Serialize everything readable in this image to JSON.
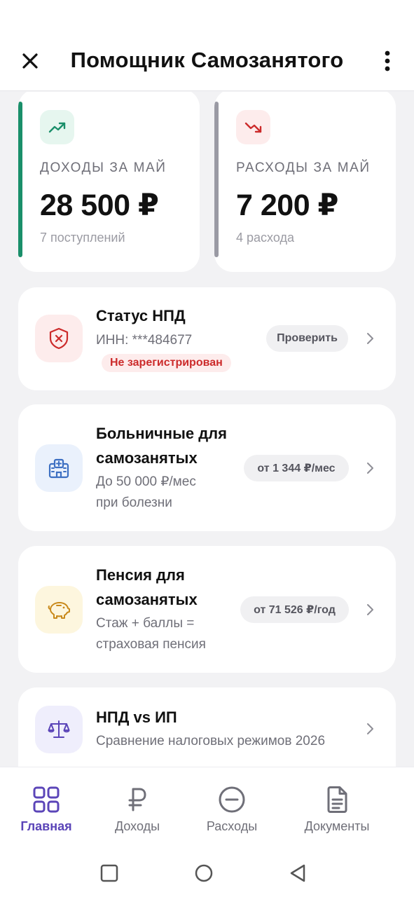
{
  "header": {
    "title": "Помощник Самозанятого"
  },
  "stats": {
    "income": {
      "label": "ДОХОДЫ ЗА МАЙ",
      "value": "28 500 ₽",
      "sub": "7 поступлений",
      "accent": "#1a8f6a"
    },
    "expense": {
      "label": "РАСХОДЫ ЗА МАЙ",
      "value": "7 200 ₽",
      "sub": "4 расхода",
      "accent": "#9a9aa4"
    }
  },
  "cards": {
    "npd": {
      "title": "Статус НПД",
      "desc": "ИНН: ***484677",
      "badge": "Не зарегистрирован",
      "action": "Проверить"
    },
    "sick": {
      "title_1": "Больничные для",
      "title_2": "самозанятых",
      "desc_1": "До 50 000 ₽/мес",
      "desc_2": "при болезни",
      "action": "от 1 344 ₽/мес"
    },
    "pension": {
      "title_1": "Пенсия для",
      "title_2": "самозанятых",
      "desc_1": "Стаж + баллы =",
      "desc_2": "страховая пенсия",
      "action": "от 71 526 ₽/год"
    },
    "compare": {
      "title": "НПД vs ИП",
      "desc": "Сравнение налоговых режимов 2026"
    }
  },
  "nav": {
    "items": [
      {
        "label": "Главная",
        "icon": "grid-icon",
        "active": true
      },
      {
        "label": "Доходы",
        "icon": "ruble-icon",
        "active": false
      },
      {
        "label": "Расходы",
        "icon": "minus-circle-icon",
        "active": false
      },
      {
        "label": "Документы",
        "icon": "document-icon",
        "active": false
      }
    ]
  },
  "colors": {
    "accent": "#5b45b8",
    "danger": "#cc2b2b",
    "income": "#1a8f6a"
  }
}
